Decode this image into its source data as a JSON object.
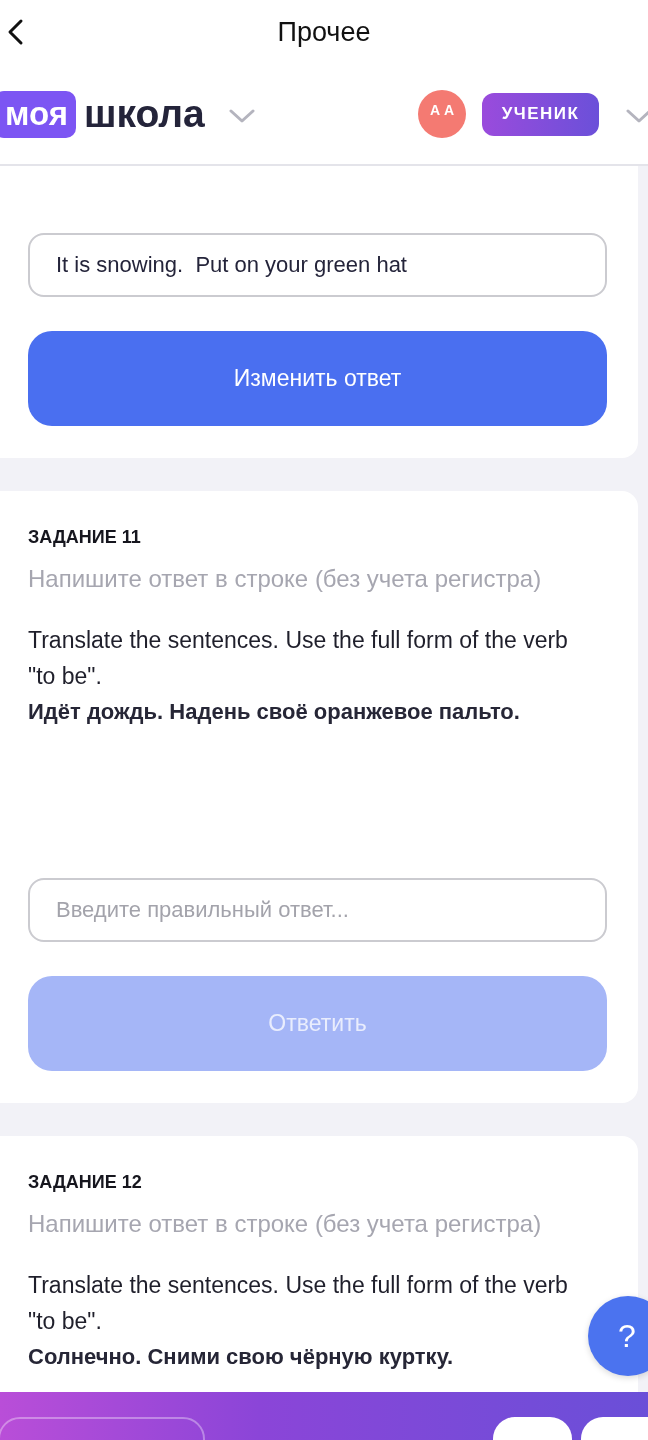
{
  "top_bar": {
    "title": "Прочее"
  },
  "header": {
    "logo": {
      "badge_text": "моя",
      "text": "школа"
    },
    "avatar": {
      "initials": "АА"
    },
    "role_badge": "УЧЕНИК"
  },
  "tasks": [
    {
      "answer": {
        "value": "It is snowing.  Put on your green hat"
      },
      "button": {
        "label": "Изменить ответ",
        "disabled": false
      }
    },
    {
      "title": "ЗАДАНИЕ 11",
      "hint": "Напишите ответ в строке (без учета регистра)",
      "question": "Translate the sentences. Use the full form of the verb \"to be\".",
      "prompt": "Идёт дождь. Надень своё оранжевое пальто.",
      "answer": {
        "placeholder": "Введите правильный ответ..."
      },
      "button": {
        "label": "Ответить",
        "disabled": true
      }
    },
    {
      "title": "ЗАДАНИЕ 12",
      "hint": "Напишите ответ в строке (без учета регистра)",
      "question": "Translate the sentences. Use the full form of the verb \"to be\".",
      "prompt": "Солнечно. Сними свою чёрную куртку."
    }
  ],
  "help_button": {
    "label": "?"
  }
}
